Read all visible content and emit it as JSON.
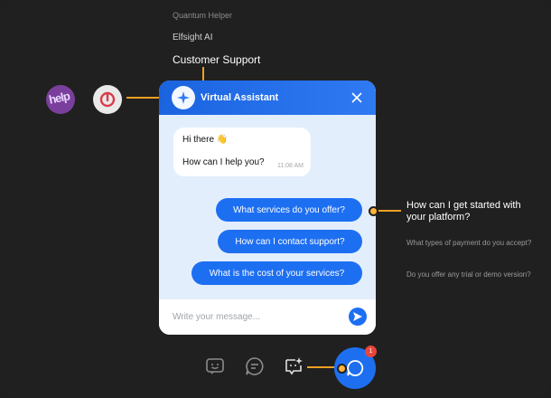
{
  "names": [
    "Quantum Helper",
    "Elfsight AI",
    "Customer Support"
  ],
  "avatar_help_text": "help",
  "header": {
    "title": "Virtual Assistant"
  },
  "greeting": {
    "line1": "Hi there 👋",
    "line2": "How can I help you?",
    "time": "11:08 AM"
  },
  "quick_replies": [
    "What services do you offer?",
    "How can I contact support?",
    "What is the cost of your services?"
  ],
  "composer": {
    "placeholder": "Write your message..."
  },
  "right_questions": [
    "How can I get started with your platform?",
    "What types of payment do you accept?",
    "Do you offer any trial or demo version?"
  ],
  "badge_count": "1",
  "colors": {
    "accent": "#1d6ff2",
    "connector": "#f0a020",
    "background": "#202020"
  }
}
